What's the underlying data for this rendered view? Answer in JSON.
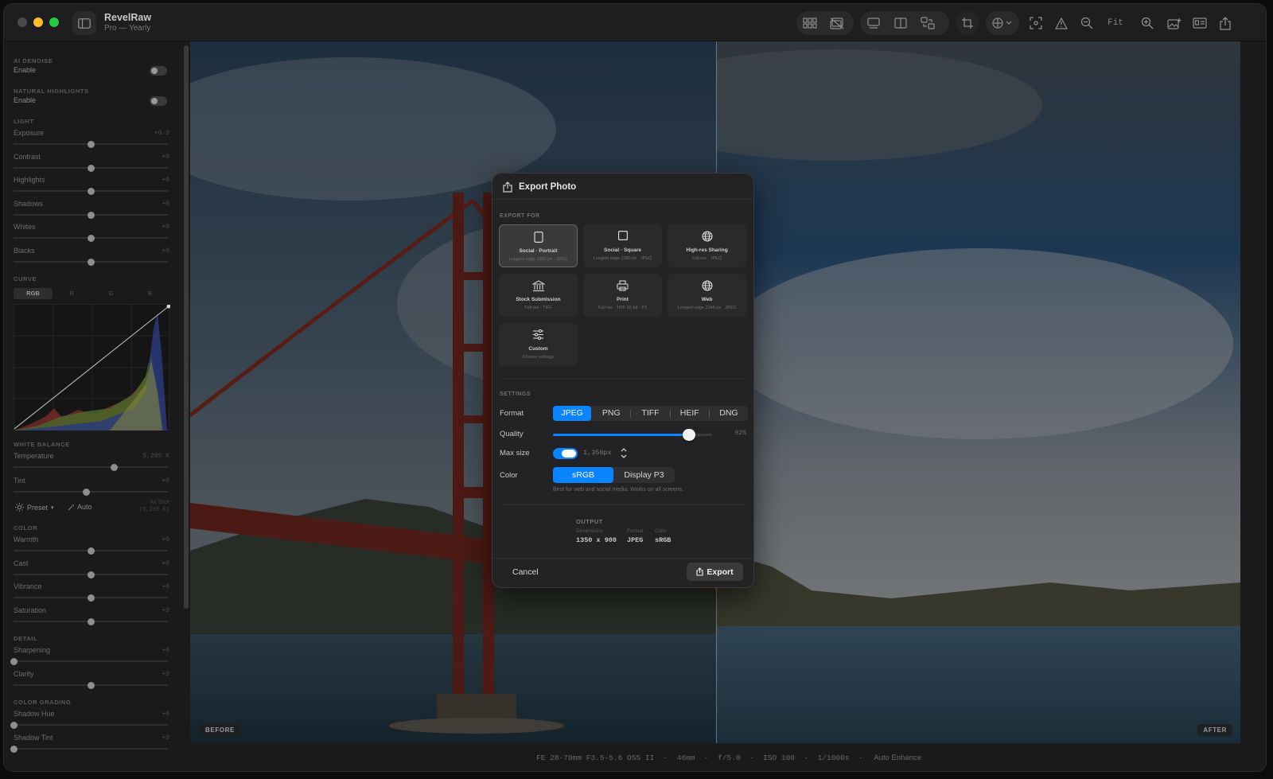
{
  "app": {
    "title": "RevelRaw",
    "subtitle": "Pro — Yearly"
  },
  "toolbar": {
    "fit_label": "Fit"
  },
  "panel": {
    "ai_denoise": {
      "section": "AI DENOISE",
      "enable_label": "Enable",
      "enabled": false
    },
    "natural_highlights": {
      "section": "NATURAL HIGHLIGHTS",
      "enable_label": "Enable",
      "enabled": false
    },
    "light": {
      "section": "LIGHT",
      "sliders": [
        {
          "label": "Exposure",
          "value": "+0.0",
          "level": 0.5
        },
        {
          "label": "Contrast",
          "value": "+0",
          "level": 0.5
        },
        {
          "label": "Highlights",
          "value": "+0",
          "level": 0.5
        },
        {
          "label": "Shadows",
          "value": "+0",
          "level": 0.5
        },
        {
          "label": "Whites",
          "value": "+0",
          "level": 0.5
        },
        {
          "label": "Blacks",
          "value": "+0",
          "level": 0.5
        }
      ]
    },
    "curve": {
      "section": "CURVE",
      "tabs": [
        "RGB",
        "R",
        "G",
        "B"
      ],
      "active_tab": "RGB"
    },
    "white_balance": {
      "section": "WHITE BALANCE",
      "sliders": [
        {
          "label": "Temperature",
          "value": "5,295 K",
          "level": 0.65
        },
        {
          "label": "Tint",
          "value": "+0",
          "level": 0.47
        }
      ],
      "preset_label": "Preset",
      "auto_label": "Auto",
      "as_shot": "As Shot",
      "as_shot_value": "(5,295 K)"
    },
    "color": {
      "section": "COLOR",
      "sliders": [
        {
          "label": "Warmth",
          "value": "+0",
          "level": 0.5
        },
        {
          "label": "Cast",
          "value": "+0",
          "level": 0.5
        },
        {
          "label": "Vibrance",
          "value": "+0",
          "level": 0.5
        },
        {
          "label": "Saturation",
          "value": "+0",
          "level": 0.5
        }
      ]
    },
    "detail": {
      "section": "DETAIL",
      "sliders": [
        {
          "label": "Sharpening",
          "value": "+0",
          "level": 0.0
        },
        {
          "label": "Clarity",
          "value": "+0",
          "level": 0.5
        }
      ]
    },
    "color_grading": {
      "section": "COLOR GRADING",
      "sliders": [
        {
          "label": "Shadow Hue",
          "value": "+0",
          "level": 0.0
        },
        {
          "label": "Shadow Tint",
          "value": "+0",
          "level": 0.0
        }
      ]
    }
  },
  "viewer": {
    "before_label": "BEFORE",
    "after_label": "AFTER"
  },
  "status": {
    "lens": "FE 28-70mm F3.5-5.6 OSS II",
    "focal": "46mm",
    "aperture": "f/5.0",
    "iso": "ISO 100",
    "shutter": "1/1000s",
    "mode": "Auto Enhance"
  },
  "export_dialog": {
    "title": "Export Photo",
    "export_for_label": "EXPORT FOR",
    "presets": [
      {
        "title": "Social · Portrait",
        "sub": "Longest edge 1350 px · JPEG",
        "icon": "portrait-icon",
        "selected": true
      },
      {
        "title": "Social · Square",
        "sub": "Longest edge 1080 px · JPEG",
        "icon": "square-icon",
        "selected": false
      },
      {
        "title": "High-res Sharing",
        "sub": "Full res · JPEG",
        "icon": "globe-icon",
        "selected": false
      },
      {
        "title": "Stock Submission",
        "sub": "Full res · TIFF",
        "icon": "bank-icon",
        "selected": false
      },
      {
        "title": "Print",
        "sub": "Full res · TIFF 16-bit · P3",
        "icon": "printer-icon",
        "selected": false
      },
      {
        "title": "Web",
        "sub": "Longest edge 2048 px · JPEG",
        "icon": "globe-icon",
        "selected": false
      },
      {
        "title": "Custom",
        "sub": "Choose settings",
        "icon": "sliders-icon",
        "selected": false
      }
    ],
    "settings_label": "SETTINGS",
    "format_label": "Format",
    "formats": [
      "JPEG",
      "PNG",
      "TIFF",
      "HEIF",
      "DNG"
    ],
    "selected_format": "JPEG",
    "quality_label": "Quality",
    "quality_value": "92%",
    "quality_level": 0.92,
    "max_size_label": "Max size",
    "max_size_enabled": true,
    "max_size_value": "1,350px",
    "color_label": "Color",
    "color_options": [
      "sRGB",
      "Display P3"
    ],
    "selected_color": "sRGB",
    "color_hint": "Best for web and social media. Works on all screens.",
    "output": {
      "label": "OUTPUT",
      "dimensions_key": "Dimensions",
      "dimensions": "1350 x 900",
      "format_key": "Format",
      "format": "JPEG",
      "color_key": "Color",
      "color": "sRGB"
    },
    "cancel_label": "Cancel",
    "export_label": "Export"
  },
  "colors": {
    "accent": "#0a84ff",
    "close": "#5a5a5d",
    "minimize": "#febc2e",
    "zoom": "#28c840"
  }
}
